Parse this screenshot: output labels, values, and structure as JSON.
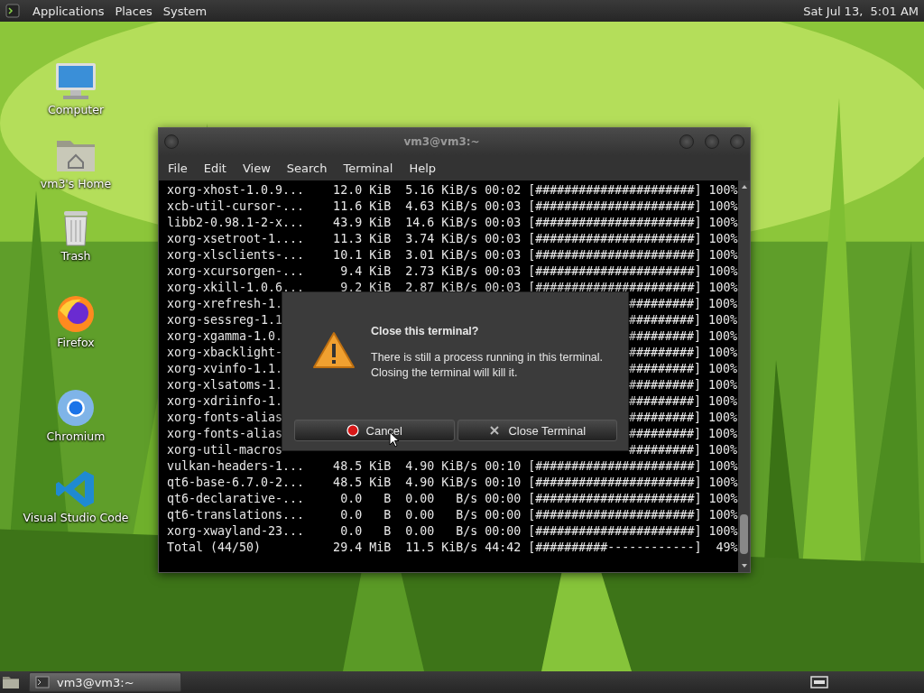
{
  "top_panel": {
    "menus": [
      "Applications",
      "Places",
      "System"
    ],
    "clock": "Sat Jul 13,  5:01 AM"
  },
  "desktop_icons": [
    {
      "label": "Computer",
      "kind": "computer"
    },
    {
      "label": "vm3's Home",
      "kind": "home"
    },
    {
      "label": "Trash",
      "kind": "trash"
    },
    {
      "label": "Firefox",
      "kind": "firefox"
    },
    {
      "label": "Chromium",
      "kind": "chromium"
    },
    {
      "label": "Visual Studio Code",
      "kind": "code"
    }
  ],
  "terminal": {
    "title": "vm3@vm3:~",
    "menu": [
      "File",
      "Edit",
      "View",
      "Search",
      "Terminal",
      "Help"
    ],
    "lines": [
      {
        "kind": "full",
        "text": "xorg-xhost-1.0.9...    12.0 KiB  5.16 KiB/s 00:02 [######################] 100%"
      },
      {
        "kind": "full",
        "text": "xcb-util-cursor-...    11.6 KiB  4.63 KiB/s 00:03 [######################] 100%"
      },
      {
        "kind": "full",
        "text": "libb2-0.98.1-2-x...    43.9 KiB  14.6 KiB/s 00:03 [######################] 100%"
      },
      {
        "kind": "full",
        "text": "xorg-xsetroot-1....    11.3 KiB  3.74 KiB/s 00:03 [######################] 100%"
      },
      {
        "kind": "full",
        "text": "xorg-xlsclients-...    10.1 KiB  3.01 KiB/s 00:03 [######################] 100%"
      },
      {
        "kind": "full",
        "text": "xorg-xcursorgen-...     9.4 KiB  2.73 KiB/s 00:03 [######################] 100%"
      },
      {
        "kind": "full",
        "text": "xorg-xkill-1.0.6...     9.2 KiB  2.87 KiB/s 00:03 [######################] 100%"
      },
      {
        "kind": "covered",
        "left": "xorg-xrefresh-1.",
        "right": "#########] 100%"
      },
      {
        "kind": "covered",
        "left": "xorg-sessreg-1.1",
        "right": "#########] 100%"
      },
      {
        "kind": "covered",
        "left": "xorg-xgamma-1.0.",
        "right": "#########] 100%"
      },
      {
        "kind": "covered",
        "left": "xorg-xbacklight-",
        "right": "#########] 100%"
      },
      {
        "kind": "covered",
        "left": "xorg-xvinfo-1.1.",
        "right": "#########] 100%"
      },
      {
        "kind": "covered",
        "left": "xorg-xlsatoms-1.",
        "right": "#########] 100%"
      },
      {
        "kind": "covered",
        "left": "xorg-xdriinfo-1.",
        "right": "#########] 100%"
      },
      {
        "kind": "covered",
        "left": "xorg-fonts-alias",
        "right": "#########] 100%"
      },
      {
        "kind": "covered",
        "left": "xorg-fonts-alias",
        "right": "#########] 100%"
      },
      {
        "kind": "covered",
        "left": "xorg-util-macros",
        "right": "#########] 100%"
      },
      {
        "kind": "full",
        "text": "vulkan-headers-1...    48.5 KiB  4.90 KiB/s 00:10 [######################] 100%"
      },
      {
        "kind": "full",
        "text": "qt6-base-6.7.0-2...    48.5 KiB  4.90 KiB/s 00:10 [######################] 100%"
      },
      {
        "kind": "full",
        "text": "qt6-declarative-...     0.0   B  0.00   B/s 00:00 [######################] 100%"
      },
      {
        "kind": "full",
        "text": "qt6-translations...     0.0   B  0.00   B/s 00:00 [######################] 100%"
      },
      {
        "kind": "full",
        "text": "xorg-xwayland-23...     0.0   B  0.00   B/s 00:00 [######################] 100%"
      },
      {
        "kind": "full",
        "text": "Total (44/50)          29.4 MiB  11.5 KiB/s 44:42 [##########------------]  49%"
      }
    ]
  },
  "dialog": {
    "title": "Close this terminal?",
    "message": "There is still a process running in this terminal.\nClosing the terminal will kill it.",
    "buttons": [
      {
        "label": "Cancel",
        "kind": "cancel"
      },
      {
        "label": "Close Terminal",
        "kind": "close"
      }
    ]
  },
  "taskbar": {
    "windows": [
      {
        "label": "vm3@vm3:~"
      }
    ]
  }
}
